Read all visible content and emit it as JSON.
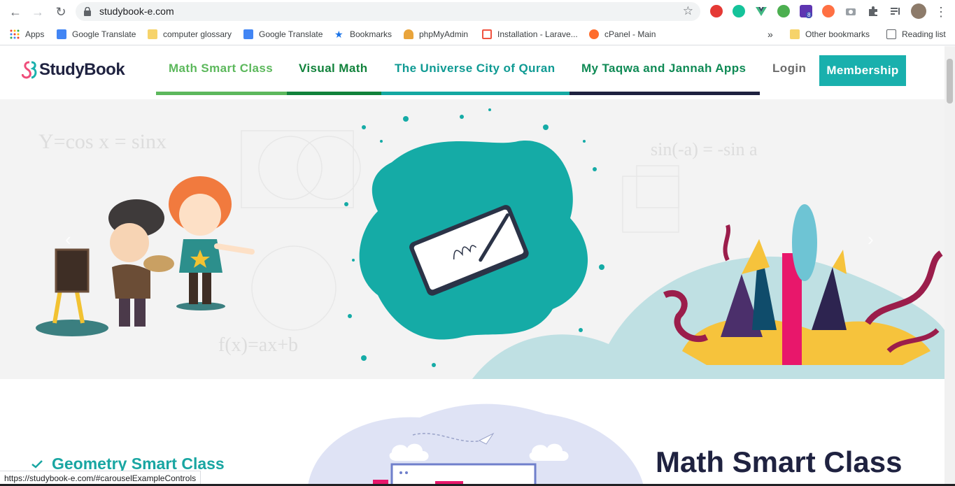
{
  "browser": {
    "url": "studybook-e.com",
    "bookmarks": [
      {
        "label": "Apps",
        "icon": "apps-grid-icon"
      },
      {
        "label": "Google Translate",
        "icon": "google-translate-icon"
      },
      {
        "label": "computer glossary",
        "icon": "folder-icon"
      },
      {
        "label": "Google Translate",
        "icon": "google-translate-icon"
      },
      {
        "label": "Bookmarks",
        "icon": "star-icon"
      },
      {
        "label": "phpMyAdmin",
        "icon": "phpmyadmin-icon"
      },
      {
        "label": "Installation - Larave...",
        "icon": "laravel-icon"
      },
      {
        "label": "cPanel - Main",
        "icon": "cpanel-icon"
      }
    ],
    "more_bookmarks": "»",
    "other_bookmarks": "Other bookmarks",
    "reading_list": "Reading list",
    "extension_badge": "8",
    "status_url": "https://studybook-e.com/#carouselExampleControls"
  },
  "site": {
    "logo_text": "StudyBook",
    "nav": [
      {
        "label": "Math Smart Class",
        "color": "#5cb85c"
      },
      {
        "label": "Visual Math",
        "color": "#11823b"
      },
      {
        "label": "The Universe City of Quran",
        "color": "#0f9a93"
      },
      {
        "label": "My Taqwa and Jannah Apps",
        "color": "#0f8a55"
      }
    ],
    "nav_bar_colors": [
      "#5cb85c",
      "#11823b",
      "#14a8a2",
      "#1f2240"
    ],
    "login": "Login",
    "membership": "Membership",
    "accent": "#19b0ad"
  },
  "hero": {
    "bg_formulas": [
      "Y=cos x = sinx",
      "sin(-a) = -sin a",
      "f(x)=ax+b"
    ],
    "prev_label": "‹",
    "next_label": "›"
  },
  "section": {
    "link_label": "Geometry Smart Class",
    "title": "Math Smart Class"
  }
}
